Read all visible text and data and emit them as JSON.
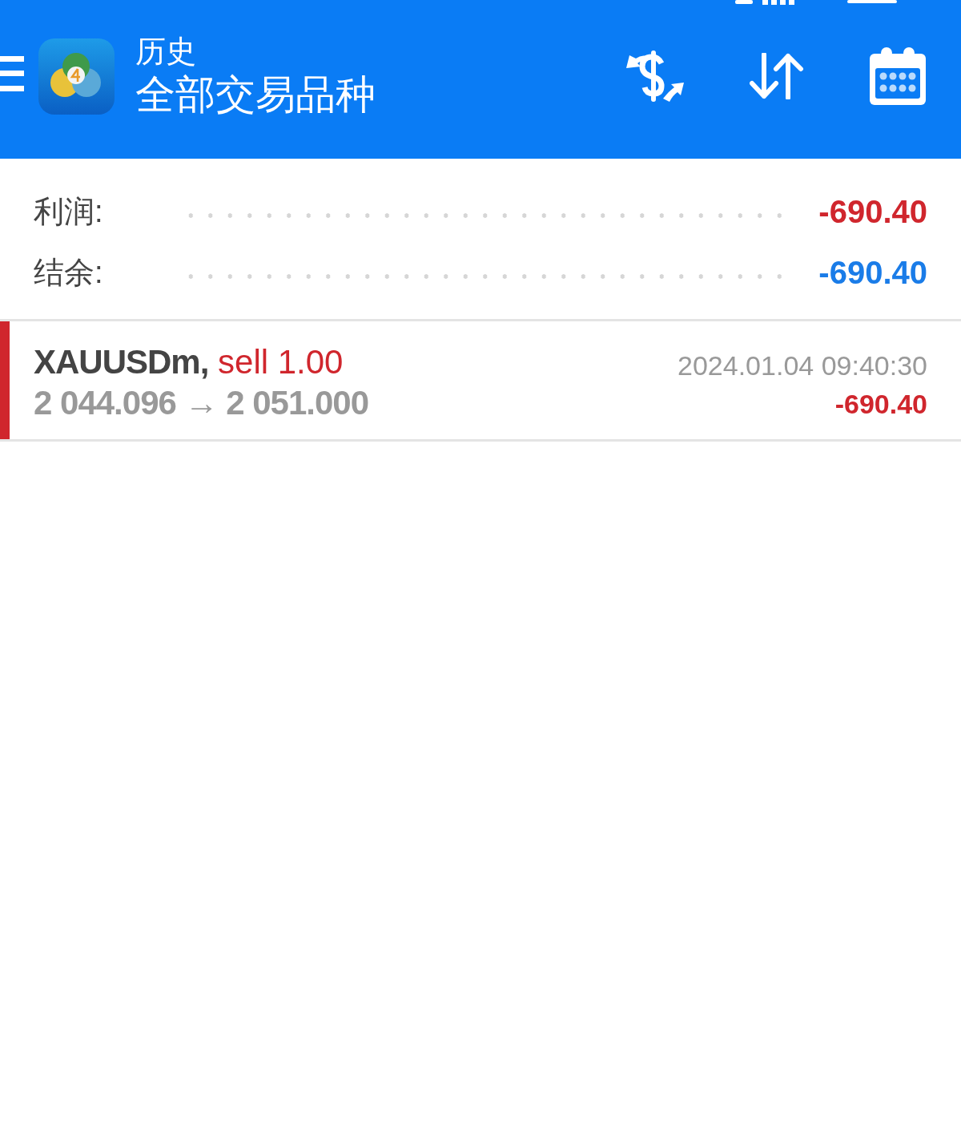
{
  "header": {
    "title": "历史",
    "subtitle": "全部交易品种"
  },
  "summary": [
    {
      "label": "利润:",
      "value": "-690.40",
      "color": "#d0262d"
    },
    {
      "label": "结余:",
      "value": "-690.40",
      "color": "#1a7ce8"
    }
  ],
  "trades": [
    {
      "kind": "sell",
      "symbol": "XAUUSDm,",
      "order": "sell 1.00",
      "prices": "2 044.096 → 2 051.000",
      "time": "2024.01.04 09:40:30",
      "profit": "-690.40"
    }
  ]
}
